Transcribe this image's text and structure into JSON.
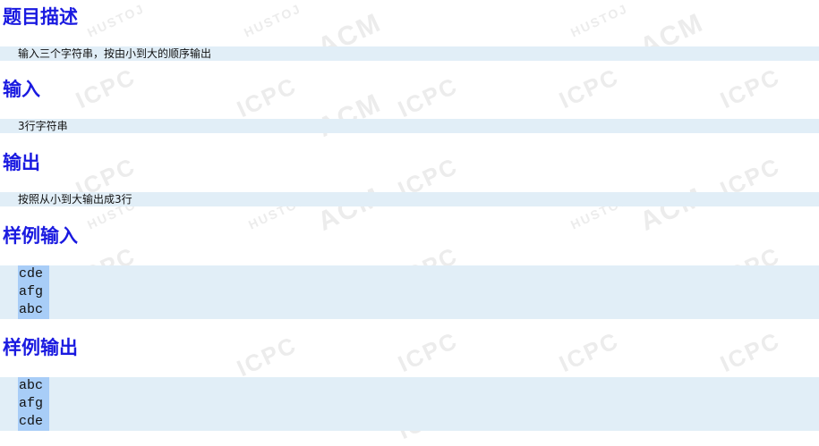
{
  "watermark": {
    "hustoj": "HUSTOJ",
    "acm": "ACM",
    "icpc": "ICPC"
  },
  "sections": {
    "description": {
      "title": "题目描述",
      "text": "输入三个字符串，按由小到大的顺序输出"
    },
    "input": {
      "title": "输入",
      "text": "3行字符串"
    },
    "output": {
      "title": "输出",
      "text": "按照从小到大输出成3行"
    },
    "sample_input": {
      "title": "样例输入",
      "lines": [
        "cde",
        "afg",
        "abc"
      ]
    },
    "sample_output": {
      "title": "样例输出",
      "lines": [
        "abc",
        "afg",
        "cde"
      ]
    }
  },
  "colors": {
    "title": "#1a1ae0",
    "band": "#e1eef7",
    "highlight": "#a8cdf7"
  }
}
